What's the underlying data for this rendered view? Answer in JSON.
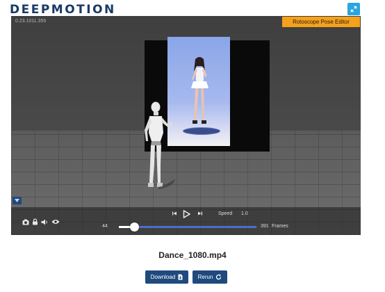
{
  "brand": {
    "logo_text": "DEEPMOTION"
  },
  "viewer": {
    "version": "0.23.1011.355",
    "roto_button": "Rotoscope Pose Editor",
    "icons": [
      "expand-icon",
      "camera-icon",
      "lock-icon",
      "volume-icon",
      "eye-icon",
      "chevron-down-icon"
    ]
  },
  "playback": {
    "current_frame": "44",
    "total_frames": "391",
    "frames_label": "Frames",
    "progress": 0.11,
    "speed_label": "Speed",
    "speed_value": "1.0"
  },
  "file": {
    "name": "Dance_1080.mp4"
  },
  "actions": {
    "download_label": "Download",
    "rerun_label": "Rerun"
  },
  "colors": {
    "accent": "#1f4a7e",
    "roto_button": "#f6a11a",
    "expand_button": "#29a6e0",
    "track": "#4a6fd0"
  }
}
